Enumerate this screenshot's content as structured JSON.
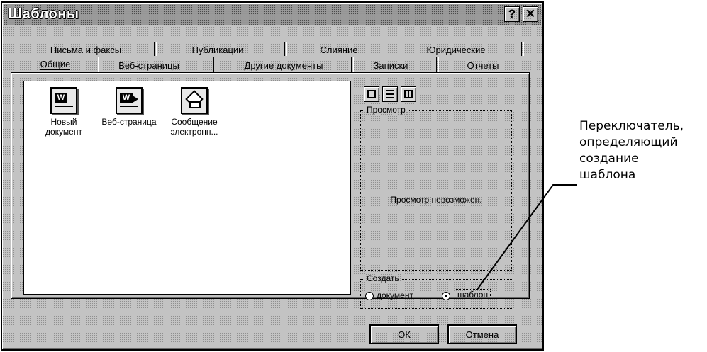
{
  "dialog": {
    "title": "Шаблоны",
    "help_button": "?",
    "close_button": "✕"
  },
  "tabs": {
    "back_row": [
      "Письма и факсы",
      "Публикации",
      "Слияние",
      "Юридические"
    ],
    "front_row": [
      "Общие",
      "Веб-страницы",
      "Другие документы",
      "Записки",
      "Отчеты"
    ],
    "active": "Общие"
  },
  "templates": [
    {
      "label": "Новый документ",
      "icon": "word-document-icon"
    },
    {
      "label": "Веб-страница",
      "icon": "web-page-icon"
    },
    {
      "label": "Сообщение электронн...",
      "icon": "email-message-icon"
    }
  ],
  "view_buttons": [
    "large-icons-view-icon",
    "list-view-icon",
    "details-view-icon"
  ],
  "preview": {
    "group_label": "Просмотр",
    "message": "Просмотр невозможен."
  },
  "create": {
    "group_label": "Создать",
    "option_document": "документ",
    "option_template": "шаблон",
    "selected": "шаблон"
  },
  "buttons": {
    "ok": "ОК",
    "cancel": "Отмена"
  },
  "annotation": {
    "line1": "Переключатель,",
    "line2": "определяющий",
    "line3": "создание",
    "line4": "шаблона"
  }
}
